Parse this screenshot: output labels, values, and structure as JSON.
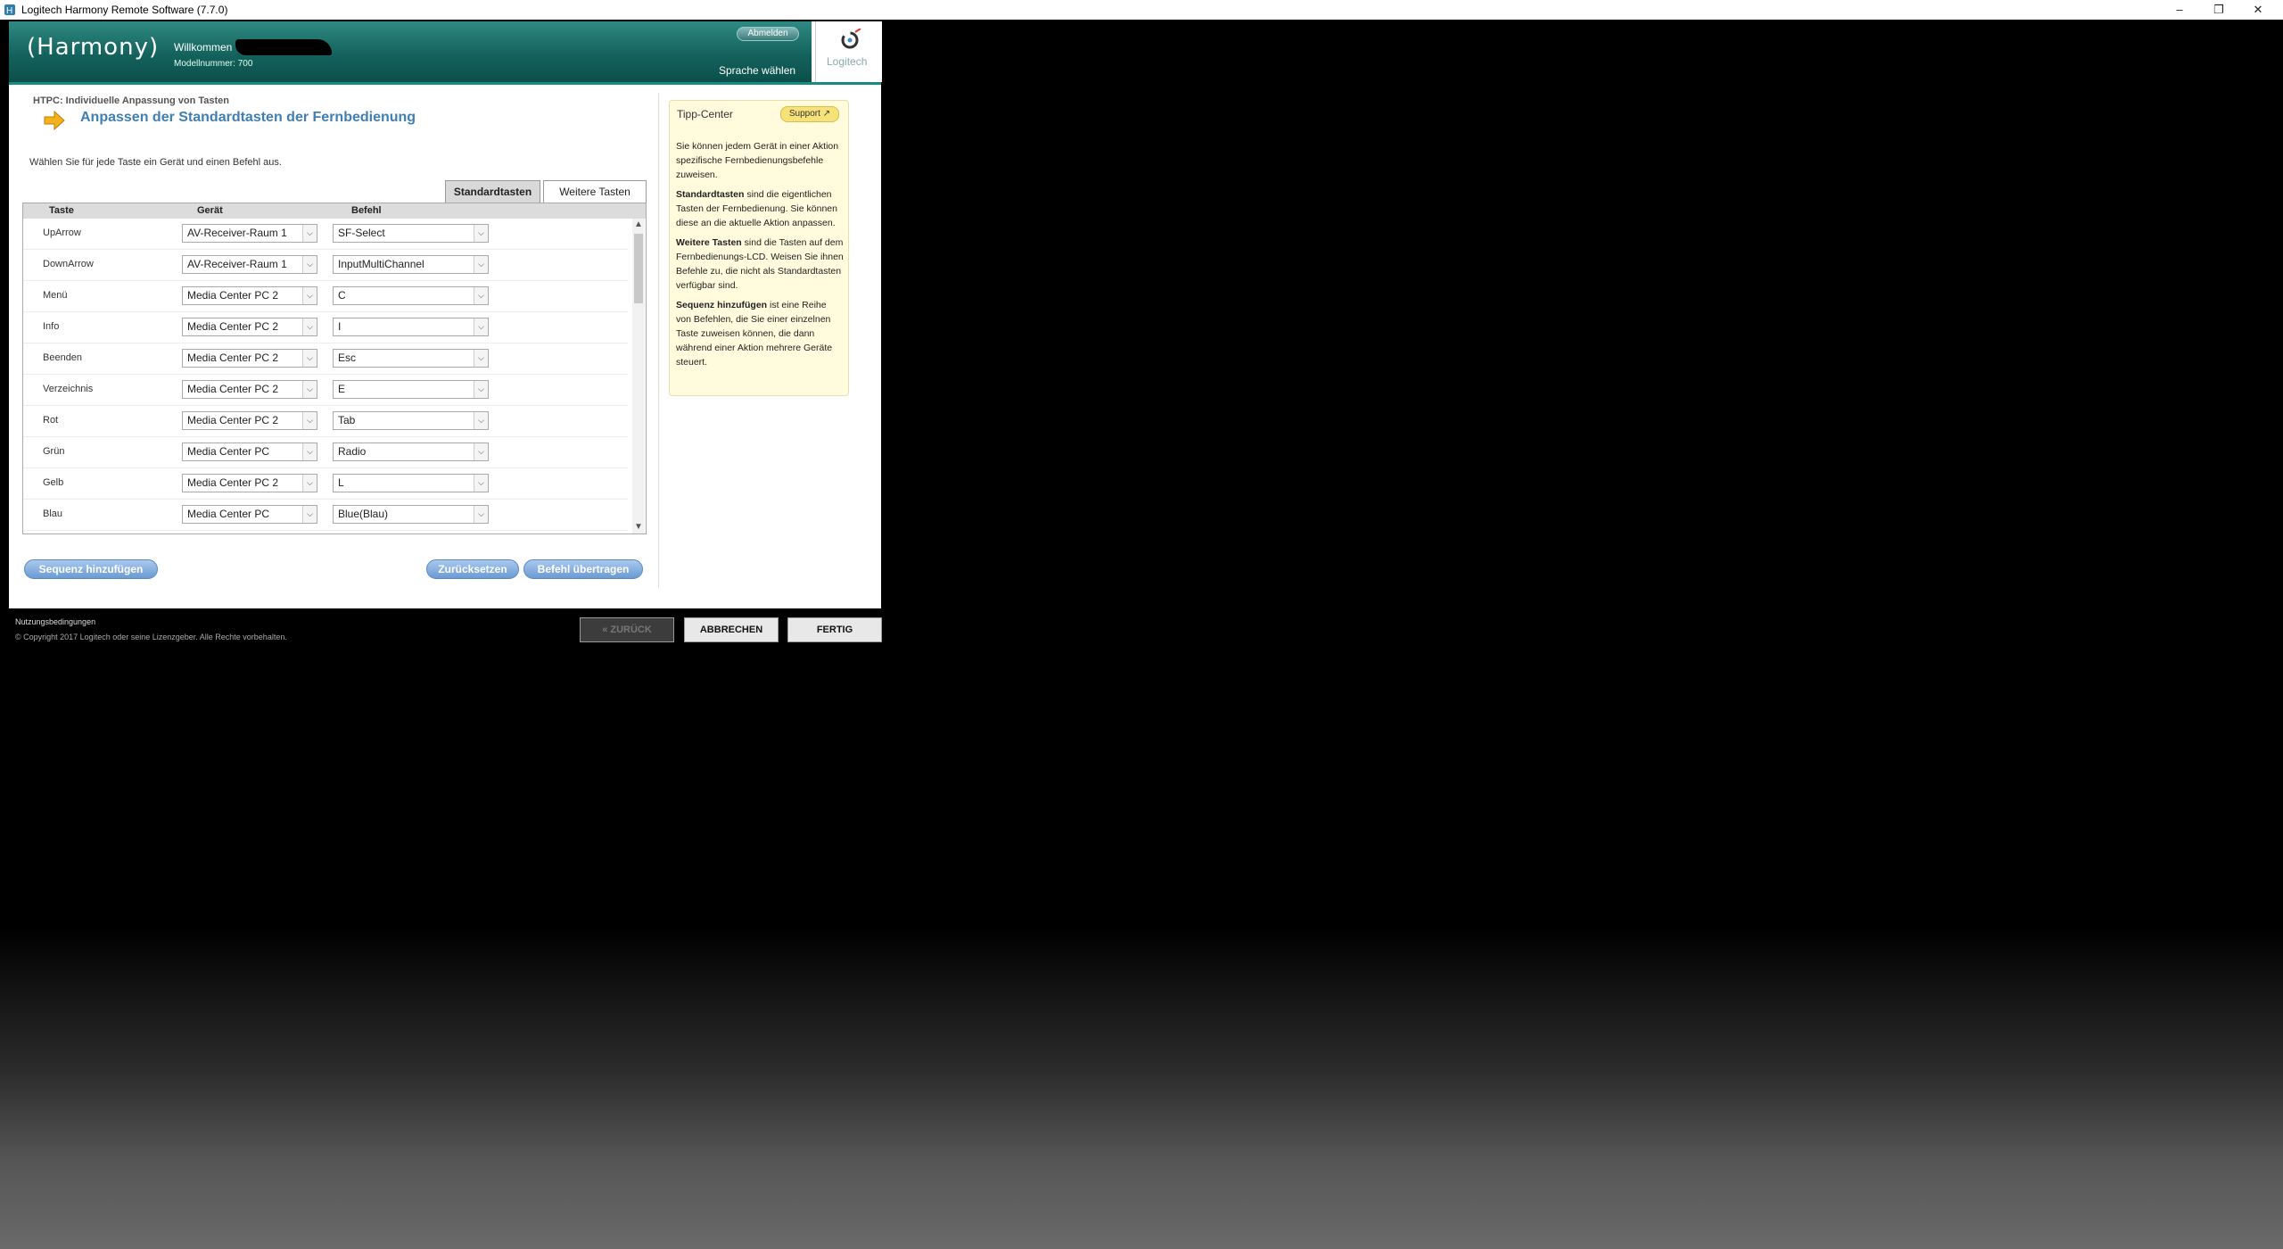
{
  "window": {
    "title": "Logitech Harmony Remote Software (7.7.0)",
    "controls": [
      "–",
      "❐",
      "✕"
    ]
  },
  "header": {
    "logo": "(Harmony)",
    "welcome": "Willkommen",
    "model": "Modellnummer: 700",
    "logout": "Abmelden",
    "language": "Sprache wählen",
    "brand": "Logitech"
  },
  "main": {
    "breadcrumb": "HTPC: Individuelle Anpassung von Tasten",
    "title": "Anpassen der Standardtasten der Fernbedienung",
    "instruction": "Wählen Sie für jede Taste ein Gerät und einen Befehl aus.",
    "tabs": [
      "Standardtasten",
      "Weitere Tasten"
    ],
    "columns": [
      "Taste",
      "Gerät",
      "Befehl"
    ],
    "rows": [
      {
        "key": "UpArrow",
        "device": "AV-Receiver-Raum 1",
        "command": "SF-Select"
      },
      {
        "key": "DownArrow",
        "device": "AV-Receiver-Raum 1",
        "command": "InputMultiChannel"
      },
      {
        "key": "Menü",
        "device": "Media Center PC 2",
        "command": "C"
      },
      {
        "key": "Info",
        "device": "Media Center PC 2",
        "command": "I"
      },
      {
        "key": "Beenden",
        "device": "Media Center PC 2",
        "command": "Esc"
      },
      {
        "key": "Verzeichnis",
        "device": "Media Center PC 2",
        "command": "E"
      },
      {
        "key": "Rot",
        "device": "Media Center PC 2",
        "command": "Tab"
      },
      {
        "key": "Grün",
        "device": "Media Center PC",
        "command": "Radio"
      },
      {
        "key": "Gelb",
        "device": "Media Center PC 2",
        "command": "L"
      },
      {
        "key": "Blau",
        "device": "Media Center PC",
        "command": "Blue(Blau)"
      }
    ],
    "add_sequence": "Sequenz hinzufügen",
    "reset": "Zurücksetzen",
    "transfer": "Befehl übertragen"
  },
  "tips": {
    "title": "Tipp-Center",
    "support": "Support",
    "p1": "Sie können jedem Gerät in einer Aktion spezifische Fernbedienungsbefehle zuweisen.",
    "p2_bold": "Standardtasten",
    "p2": " sind die eigentlichen Tasten der Fernbedienung. Sie können diese an die aktuelle Aktion anpassen.",
    "p3_bold": "Weitere Tasten",
    "p3": " sind die Tasten auf dem Fernbedienungs-LCD. Weisen Sie ihnen Befehle zu, die nicht als Standardtasten verfügbar sind.",
    "p4_bold": "Sequenz hinzufügen",
    "p4": " ist eine Reihe von Befehlen, die Sie einer einzelnen Taste zuweisen können, die dann während einer Aktion mehrere Geräte steuert."
  },
  "footer": {
    "terms": "Nutzungsbedingungen",
    "copyright": "© Copyright 2017 Logitech oder seine Lizenzgeber. Alle Rechte vorbehalten.",
    "back": "« ZURÜCK",
    "cancel": "ABBRECHEN",
    "done": "FERTIG"
  }
}
